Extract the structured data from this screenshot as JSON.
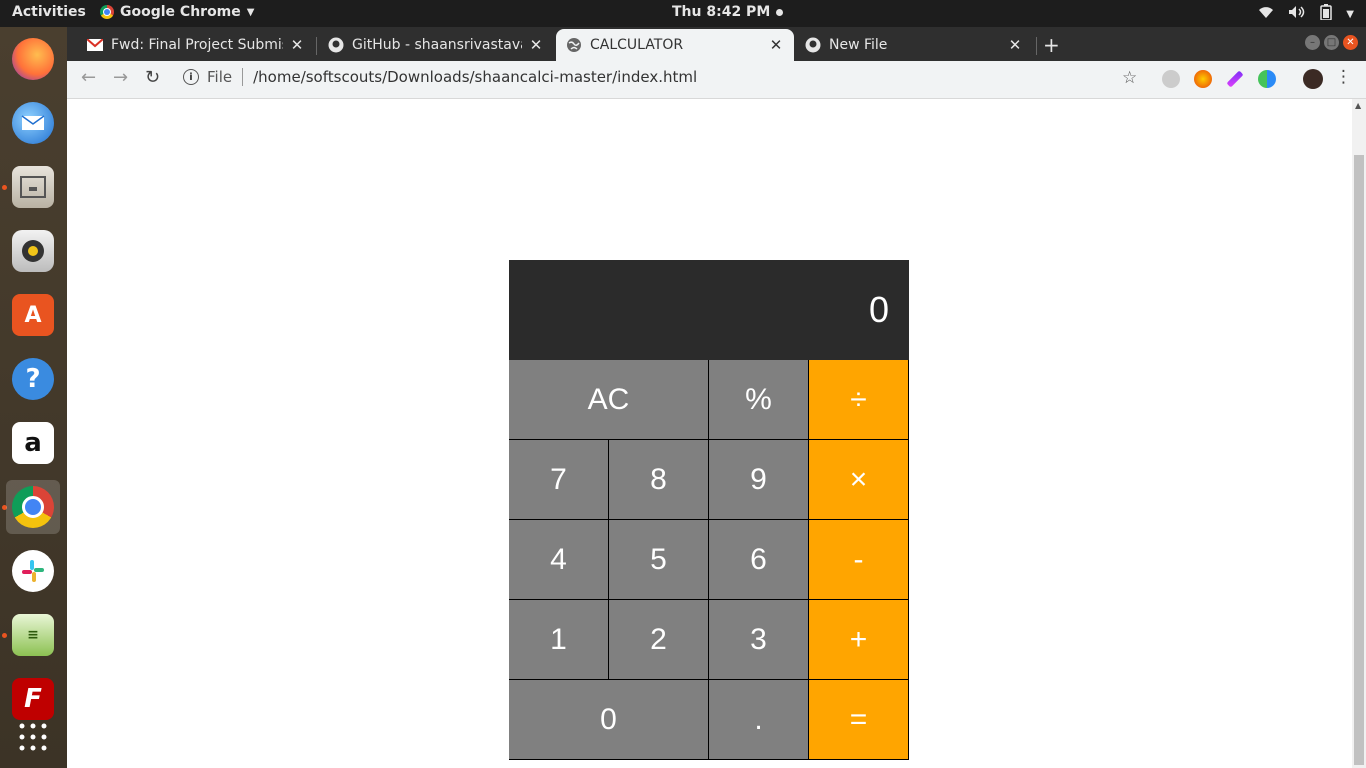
{
  "topbar": {
    "activities": "Activities",
    "app_name": "Google Chrome",
    "clock": "Thu  8:42 PM"
  },
  "dock": {
    "items": [
      {
        "name": "firefox-icon"
      },
      {
        "name": "thunderbird-icon"
      },
      {
        "name": "files-icon"
      },
      {
        "name": "rhythmbox-icon"
      },
      {
        "name": "software-center-icon"
      },
      {
        "name": "help-icon"
      },
      {
        "name": "amazon-icon"
      },
      {
        "name": "chrome-icon"
      },
      {
        "name": "slack-icon"
      },
      {
        "name": "text-editor-icon"
      },
      {
        "name": "filezilla-icon"
      },
      {
        "name": "show-apps-icon"
      }
    ]
  },
  "browser": {
    "tabs": [
      {
        "title": "Fwd: Final Project Submis",
        "favicon": "gmail-icon"
      },
      {
        "title": "GitHub - shaansrivastava/",
        "favicon": "github-icon"
      },
      {
        "title": "CALCULATOR",
        "favicon": "globe-icon"
      },
      {
        "title": "New File",
        "favicon": "github-icon"
      }
    ],
    "active_tab": 2,
    "url_scheme": "File",
    "url": "/home/softscouts/Downloads/shaancalci-master/index.html"
  },
  "calculator": {
    "display": "0",
    "keys": {
      "ac": "AC",
      "percent": "%",
      "divide": "÷",
      "seven": "7",
      "eight": "8",
      "nine": "9",
      "multiply": "×",
      "four": "4",
      "five": "5",
      "six": "6",
      "minus": "-",
      "one": "1",
      "two": "2",
      "three": "3",
      "plus": "+",
      "zero": "0",
      "decimal": ".",
      "equals": "="
    },
    "colors": {
      "display_bg": "#2b2b2b",
      "key_bg": "#808080",
      "operator_bg": "#ffa500"
    }
  }
}
